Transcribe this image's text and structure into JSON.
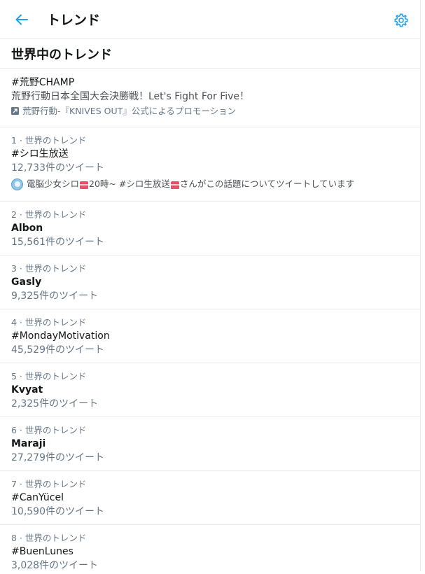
{
  "header": {
    "title": "トレンド"
  },
  "section": {
    "title": "世界中のトレンド"
  },
  "promoted": {
    "tag": "#荒野CHAMP",
    "description": "荒野行動日本全国大会決勝戦！Let's Fight For Five！",
    "promoted_by": "荒野行動-『KNIVES OUT』公式によるプロモーション",
    "icon": "promoted-icon"
  },
  "trends": [
    {
      "meta": "1 · 世界のトレンド",
      "name": "#シロ生放送",
      "count": "12,733件のツイート",
      "context": {
        "pre": "電脳少女シロ",
        "mid": "20時~ #シロ生放送",
        "post": "さんがこの話題についてツイートしています"
      }
    },
    {
      "meta": "2 · 世界のトレンド",
      "name": "Albon",
      "count": "15,561件のツイート"
    },
    {
      "meta": "3 · 世界のトレンド",
      "name": "Gasly",
      "count": "9,325件のツイート"
    },
    {
      "meta": "4 · 世界のトレンド",
      "name": "#MondayMotivation",
      "count": "45,529件のツイート"
    },
    {
      "meta": "5 · 世界のトレンド",
      "name": "Kvyat",
      "count": "2,325件のツイート"
    },
    {
      "meta": "6 · 世界のトレンド",
      "name": "Maraji",
      "count": "27,279件のツイート"
    },
    {
      "meta": "7 · 世界のトレンド",
      "name": "#CanYücel",
      "count": "10,590件のツイート"
    },
    {
      "meta": "8 · 世界のトレンド",
      "name": "#BuenLunes",
      "count": "3,028件のツイート"
    }
  ],
  "colors": {
    "accent": "#1da1f2",
    "text": "#14171a",
    "muted": "#657786",
    "divider": "#e6ecf0"
  }
}
